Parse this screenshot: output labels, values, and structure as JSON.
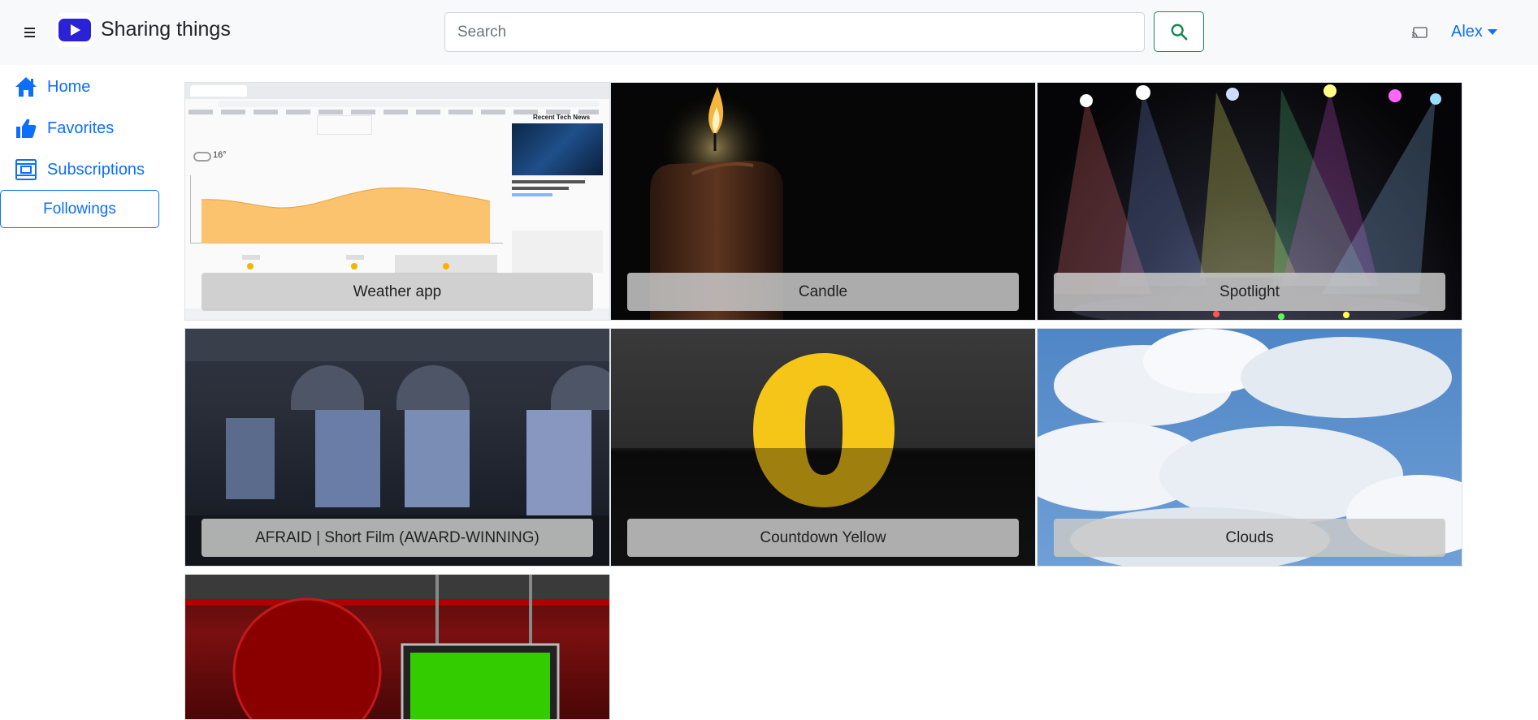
{
  "header": {
    "brand": "Sharing things",
    "search_placeholder": "Search",
    "user_name": "Alex"
  },
  "sidebar": {
    "items": [
      {
        "label": "Home",
        "icon": "home-icon"
      },
      {
        "label": "Favorites",
        "icon": "thumbs-up-icon"
      },
      {
        "label": "Subscriptions",
        "icon": "subscriptions-icon"
      }
    ],
    "following_button": "Followings"
  },
  "colors": {
    "accent": "#0d6efd",
    "brand_logo": "#2b21d6",
    "search_button_border": "#198754",
    "header_bg": "#f8f9fa"
  },
  "videos": [
    {
      "title": "Weather app",
      "thumbnail": "weather-app-screenshot"
    },
    {
      "title": "Candle",
      "thumbnail": "candle-flame"
    },
    {
      "title": "Spotlight",
      "thumbnail": "stage-spotlights"
    },
    {
      "title": "AFRAID | Short Film (AWARD-WINNING)",
      "thumbnail": "night-storefront"
    },
    {
      "title": "Countdown Yellow",
      "thumbnail": "yellow-zero-digit"
    },
    {
      "title": "Clouds",
      "thumbnail": "blue-sky-clouds"
    },
    {
      "title": "",
      "thumbnail": "news-studio-green-screen"
    }
  ],
  "weather_thumb": {
    "temperature": "16°",
    "side_title": "Recent Tech News"
  }
}
